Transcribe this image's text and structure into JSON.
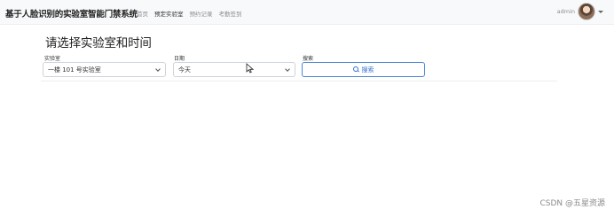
{
  "navbar": {
    "brand": "基于人脸识别的实验室智能门禁系统",
    "links": [
      "首页",
      "预定实验室",
      "预约记录",
      "考勤签到"
    ],
    "active_index": 1,
    "username": "admin"
  },
  "main": {
    "title": "请选择实验室和时间",
    "lab": {
      "label": "实验室",
      "value": "一楼 101 号实验室"
    },
    "date": {
      "label": "日期",
      "value": "今天"
    },
    "search": {
      "label": "搜索",
      "button_label": "搜索"
    }
  },
  "watermark": "CSDN @五星资源",
  "colors": {
    "navbar_bg": "#f8f9fa",
    "accent": "#2f6fcf",
    "border": "#ced4da"
  }
}
